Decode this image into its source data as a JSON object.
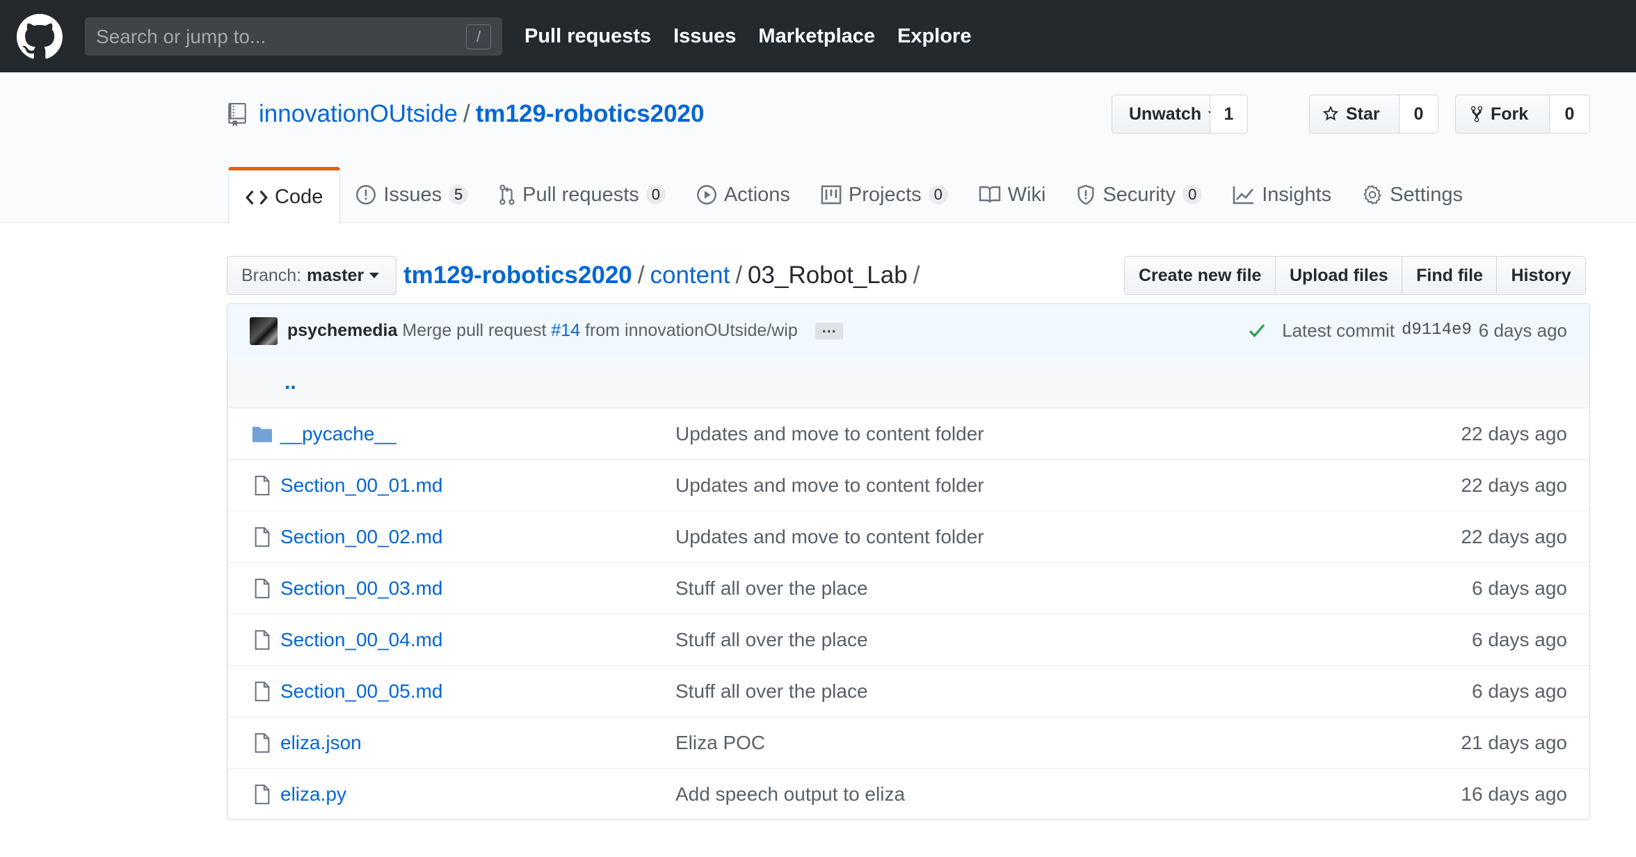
{
  "header": {
    "search_placeholder": "Search or jump to...",
    "search_shortcut": "/",
    "nav": [
      "Pull requests",
      "Issues",
      "Marketplace",
      "Explore"
    ]
  },
  "repo": {
    "owner": "innovationOUtside",
    "separator": "/",
    "name": "tm129-robotics2020",
    "actions": {
      "watch": {
        "label": "Unwatch",
        "count": "1"
      },
      "star": {
        "label": "Star",
        "count": "0"
      },
      "fork": {
        "label": "Fork",
        "count": "0"
      }
    }
  },
  "tabs": [
    {
      "label": "Code",
      "icon": "code-icon",
      "counter": null,
      "selected": true
    },
    {
      "label": "Issues",
      "icon": "issue-icon",
      "counter": "5"
    },
    {
      "label": "Pull requests",
      "icon": "pull-request-icon",
      "counter": "0"
    },
    {
      "label": "Actions",
      "icon": "play-icon",
      "counter": null
    },
    {
      "label": "Projects",
      "icon": "project-icon",
      "counter": "0"
    },
    {
      "label": "Wiki",
      "icon": "book-icon",
      "counter": null
    },
    {
      "label": "Security",
      "icon": "shield-icon",
      "counter": "0"
    },
    {
      "label": "Insights",
      "icon": "graph-icon",
      "counter": null
    },
    {
      "label": "Settings",
      "icon": "gear-icon",
      "counter": null
    }
  ],
  "branch": {
    "label": "Branch:",
    "value": "master"
  },
  "breadcrumb": {
    "repo": "tm129-robotics2020",
    "folder": "content",
    "current": "03_Robot_Lab",
    "separator": "/"
  },
  "file_actions": [
    "Create new file",
    "Upload files",
    "Find file",
    "History"
  ],
  "commit": {
    "author": "psychemedia",
    "message_prefix": "Merge pull request",
    "pr": "#14",
    "message_suffix": "from innovationOUtside/wip",
    "ellipsis": "…",
    "latest_label": "Latest commit",
    "sha": "d9114e9",
    "age": "6 days ago",
    "status_color": "#28a745"
  },
  "files": {
    "up_link": "..",
    "rows": [
      {
        "type": "folder",
        "name": "__pycache__",
        "message": "Updates and move to content folder",
        "age": "22 days ago"
      },
      {
        "type": "file",
        "name": "Section_00_01.md",
        "message": "Updates and move to content folder",
        "age": "22 days ago"
      },
      {
        "type": "file",
        "name": "Section_00_02.md",
        "message": "Updates and move to content folder",
        "age": "22 days ago"
      },
      {
        "type": "file",
        "name": "Section_00_03.md",
        "message": "Stuff all over the place",
        "age": "6 days ago"
      },
      {
        "type": "file",
        "name": "Section_00_04.md",
        "message": "Stuff all over the place",
        "age": "6 days ago"
      },
      {
        "type": "file",
        "name": "Section_00_05.md",
        "message": "Stuff all over the place",
        "age": "6 days ago"
      },
      {
        "type": "file",
        "name": "eliza.json",
        "message": "Eliza POC",
        "age": "21 days ago"
      },
      {
        "type": "file",
        "name": "eliza.py",
        "message": "Add speech output to eliza",
        "age": "16 days ago"
      }
    ]
  },
  "colors": {
    "header_bg": "#24292e",
    "link": "#0366d6",
    "tab_accent": "#e36209",
    "folder_icon": "#79b8ff"
  }
}
